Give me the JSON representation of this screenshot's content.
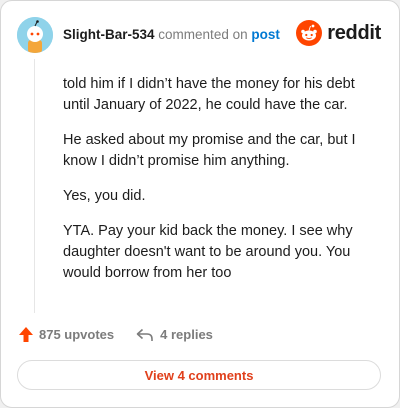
{
  "comment": {
    "username": "Slight-Bar-534",
    "action_text": "commented on",
    "post_link": "post",
    "paragraphs": [
      "told him if I didn’t have the money for his debt until January of 2022, he could have the car.",
      "He asked about my promise and the car, but I know I didn’t promise him anything.",
      "Yes, you did.",
      "YTA. Pay your kid back the money. I see why daughter doesn't want to be around you. You would borrow from her too"
    ]
  },
  "brand": {
    "logo_text": "reddit",
    "accent_color": "#ff4500"
  },
  "actions": {
    "upvotes_label": "875 upvotes",
    "replies_label": "4 replies",
    "view_comments_label": "View 4 comments"
  },
  "icons": [
    "avatar-icon",
    "reddit-logo-icon",
    "upvote-arrow-icon",
    "reply-arrow-icon"
  ]
}
